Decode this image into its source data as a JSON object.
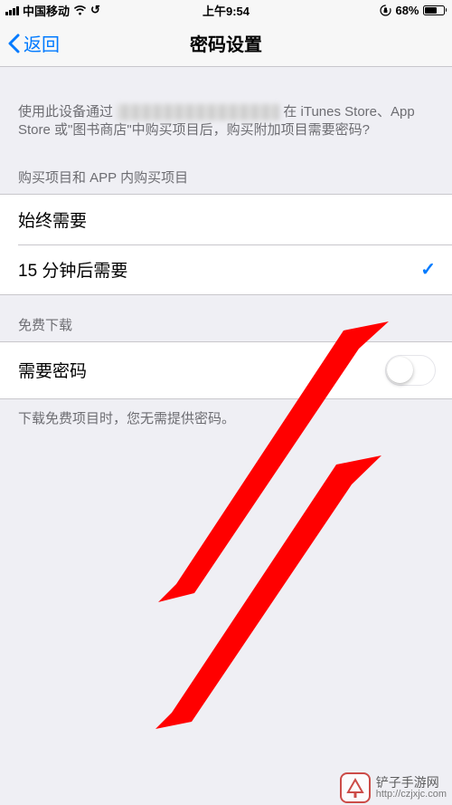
{
  "status": {
    "carrier": "中国移动",
    "time": "上午9:54",
    "battery_pct": "68%",
    "battery_fill_pct": 68
  },
  "nav": {
    "back_label": "返回",
    "title": "密码设置"
  },
  "intro": {
    "prefix": "使用此设备通过",
    "suffix": "在 iTunes Store、App Store 或\"图书商店\"中购买项目后，购买附加项目需要密码?"
  },
  "purchase_section": {
    "header": "购买项目和 APP 内购买项目",
    "option_always": "始终需要",
    "option_after_15": "15 分钟后需要",
    "selected": "option_after_15"
  },
  "free_section": {
    "header": "免费下载",
    "require_password_label": "需要密码",
    "require_password_on": false,
    "footer": "下载免费项目时，您无需提供密码。"
  },
  "watermark": {
    "name": "铲子手游网",
    "url": "http://czjxjc.com"
  }
}
